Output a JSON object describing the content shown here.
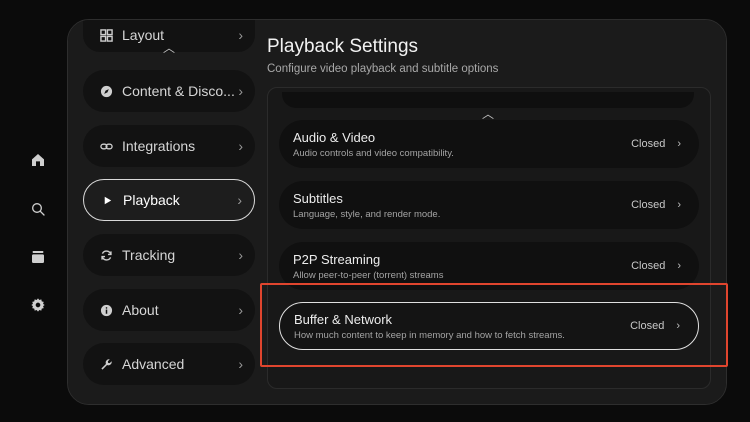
{
  "rail": {
    "items": [
      {
        "name": "home-icon"
      },
      {
        "name": "search-icon"
      },
      {
        "name": "library-icon"
      },
      {
        "name": "settings-icon"
      }
    ]
  },
  "sidebar": {
    "items": [
      {
        "label": "Layout",
        "icon": "layout-grid-icon"
      },
      {
        "label": "Content & Disco...",
        "icon": "compass-icon"
      },
      {
        "label": "Integrations",
        "icon": "link-icon"
      },
      {
        "label": "Playback",
        "icon": "play-icon",
        "active": true
      },
      {
        "label": "Tracking",
        "icon": "sync-icon"
      },
      {
        "label": "About",
        "icon": "info-icon"
      },
      {
        "label": "Advanced",
        "icon": "wrench-icon"
      }
    ],
    "chevron": "›",
    "scroll_up": "︿"
  },
  "page": {
    "title": "Playback Settings",
    "subtitle": "Configure video playback and subtitle options"
  },
  "sections": [
    {
      "name": "Audio & Video",
      "desc": "Audio controls and video compatibility.",
      "status": "Closed"
    },
    {
      "name": "Subtitles",
      "desc": "Language, style, and render mode.",
      "status": "Closed"
    },
    {
      "name": "P2P Streaming",
      "desc": "Allow peer-to-peer (torrent) streams",
      "status": "Closed"
    },
    {
      "name": "Buffer & Network",
      "desc": "How much content to keep in memory and how to fetch streams.",
      "status": "Closed",
      "focused": true
    }
  ],
  "chevron": "›",
  "colors": {
    "accent_highlight": "#e0452e",
    "background": "#0b0b0b"
  }
}
